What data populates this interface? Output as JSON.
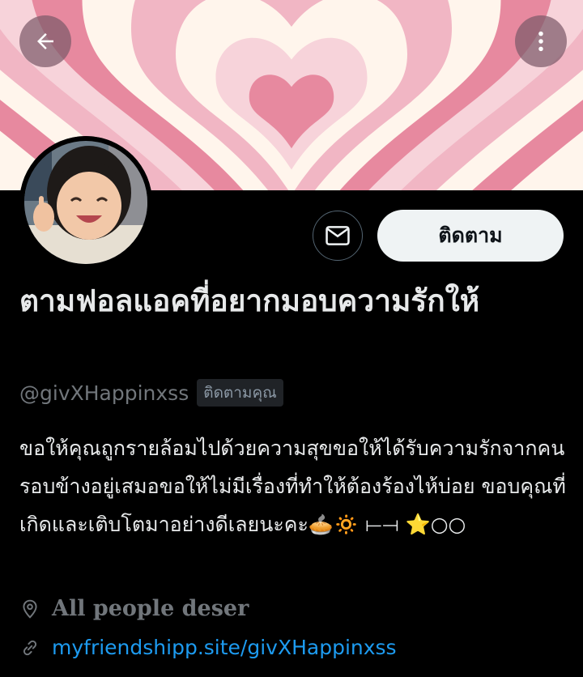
{
  "header": {
    "back_icon": "arrow-left-icon",
    "more_icon": "more-vertical-icon",
    "banner_colors": [
      "#e7899f",
      "#f7d3da",
      "#fff5ec",
      "#f1b6c4"
    ]
  },
  "profile": {
    "display_name": "ตามฟอลแอคที่อยากมอบความรักให้",
    "handle": "@givXHappinxss",
    "follows_you_badge": "ติดตามคุณ",
    "follow_button": "ติดตาม",
    "message_icon": "mail-icon",
    "bio": "ขอให้คุณถูกรายล้อมไปด้วยความสุขขอให้ได้รับความรักจากคนรอบข้างอยู่เสมอขอให้ไม่มีเรื่องที่ทำให้ต้องร้องไห้บ่อย ขอบคุณที่เกิดและเติบโตมาอย่างดีเลยนะคะ🥧🔅 ⟝⟞ ⭐○○",
    "location": "All people deser",
    "location_icon": "location-pin-icon",
    "link": "myfriendshipp.site/givXHappinxss",
    "link_icon": "link-icon"
  }
}
